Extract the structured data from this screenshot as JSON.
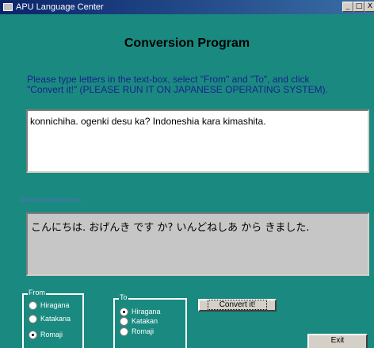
{
  "window": {
    "title": "APU Language Center",
    "controls": {
      "minimize": "_",
      "maximize": "□",
      "close": "X"
    }
  },
  "header": {
    "title": "Conversion Program"
  },
  "instructions": {
    "line1": "Please type letters in the text-box, select \"From\" and \"To\", and click",
    "line2": "\"Convert it!\" (PLEASE RUN IT ON JAPANESE OPERATING SYSTEM)."
  },
  "input": {
    "value": "konnichiha. ogenki desu ka? Indoneshia kara kimashita."
  },
  "result": {
    "label": "See the result in here.",
    "value": "こんにちは. おげんき です か? いんどねしあ から きました."
  },
  "from_group": {
    "legend": "From",
    "options": [
      {
        "label": "Hiragana",
        "checked": false
      },
      {
        "label": "Katakana",
        "checked": false
      },
      {
        "label": "Romaji",
        "checked": true
      }
    ]
  },
  "to_group": {
    "legend": "To",
    "options": [
      {
        "label": "Hiragana",
        "checked": true
      },
      {
        "label": "Katakan",
        "checked": false
      },
      {
        "label": "Romaji",
        "checked": false
      }
    ]
  },
  "buttons": {
    "convert": "Convert it!",
    "exit": "Exit"
  },
  "colors": {
    "background": "#1a8a80",
    "instructions": "#1a1f8f",
    "result_bg": "#c6c6c6"
  }
}
